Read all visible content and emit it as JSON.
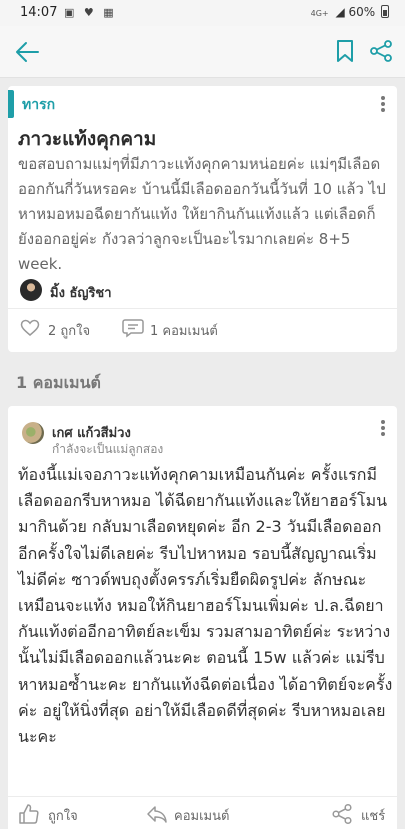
{
  "statusbar": {
    "time": "14:07",
    "network": "4G+",
    "battery": "60%"
  },
  "appbar": {
    "back_icon": "arrow-left-icon",
    "bookmark_icon": "bookmark-icon",
    "share_icon": "share-icon"
  },
  "post": {
    "category": "ทารก",
    "title": "ภาวะแท้งคุกคาม",
    "body": "ขอสอบถามแม่ๆที่มีภาวะแท้งคุกคามหน่อยค่ะ แม่ๆมีเลือดออกกันกี่วันหรอคะ บ้านนี้มีเลือดออกวันนี้วันที่ 10 แล้ว ไปหาหมอหมอฉีดยากันแท้ง ให้ยากินกันแท้งแล้ว แต่เลือดก็ยังออกอยู่ค่ะ กังวลว่าลูกจะเป็นอะไรมากเลยค่ะ 8+5 week.",
    "author": "มิ้ง ธัญริชา",
    "likes": "2 ถูกใจ",
    "comments": "1 คอมเมนต์"
  },
  "comments_header": "1 คอมเมนต์",
  "comment": {
    "author": "เกศ แก้วสีม่วง",
    "subtitle": "กำลังจะเป็นแม่ลูกสอง",
    "body": "ท้องนี้แม่เจอภาวะแท้งคุกคามเหมือนกันค่ะ ครั้งแรกมีเลือดออกรีบหาหมอ ได้ฉีดยากันแท้งและให้ยาฮอร์โมนมากินด้วย กลับมาเลือดหยุดค่ะ อีก 2-3 วันมีเลือดออกอีกครั้งใจไม่ดีเลยค่ะ รีบไปหาหมอ รอบนี้สัญญาณเริ่มไม่ดีค่ะ ซาวด์พบถุงตั้งครรภ์เริ่มยืดผิดรูปค่ะ ลักษณะเหมือนจะแท้ง หมอให้กินยาฮอร์โมนเพิ่มค่ะ ป.ล.ฉีดยากันแท้งต่ออีกอาทิตย์ละเข็ม รวมสามอาทิตย์ค่ะ ระหว่างนั้นไม่มีเลือดออกแล้วนะคะ ตอนนี้ 15w แล้วค่ะ แม่รีบหาหมอซ้ำนะคะ ยากันแท้งฉีดต่อเนื่อง ได้อาทิตย์จะครั้งค่ะ อยู่ให้นิ่งที่สุด อย่าให้มีเลือดดีที่สุดค่ะ รีบหาหมอเลยนะคะ",
    "like_label": "ถูกใจ",
    "reply_label": "คอมเมนต์",
    "share_label": "แชร์"
  },
  "colors": {
    "accent": "#1e9ea8",
    "background": "#ececec",
    "card": "#ffffff"
  }
}
